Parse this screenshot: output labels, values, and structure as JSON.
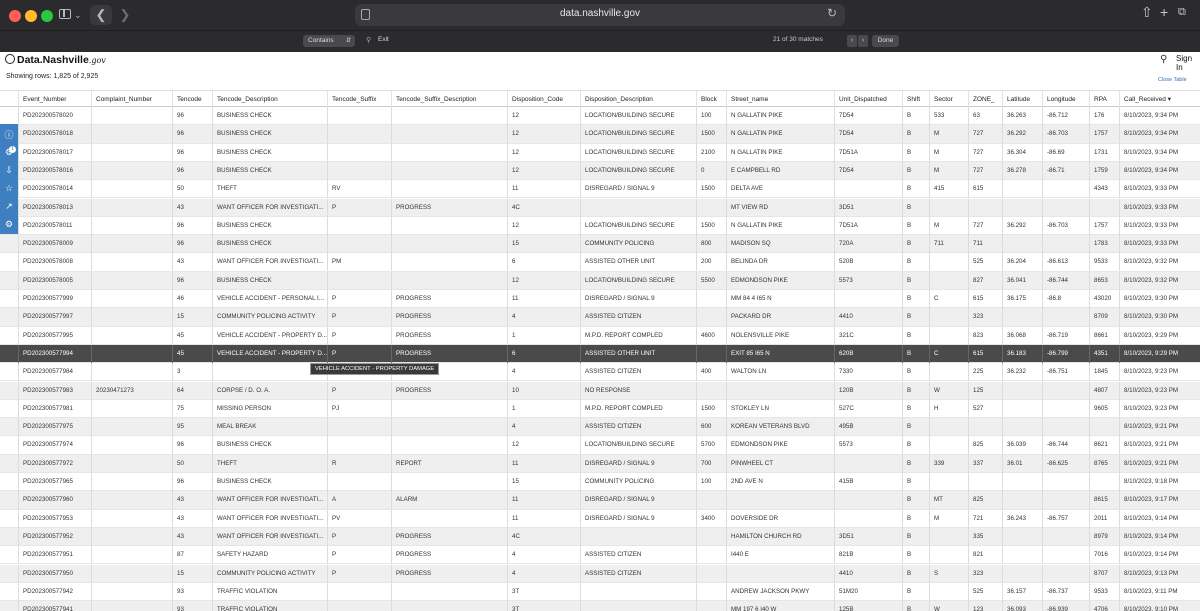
{
  "browser": {
    "url": "data.nashville.gov",
    "find": {
      "mode": "Contains",
      "query": "Exit",
      "match_count": "21 of 30 matches",
      "done_label": "Done"
    }
  },
  "header": {
    "logo_main": "Data.Nashville",
    "logo_suffix": ".gov",
    "sign_in": "Sign In",
    "showing_rows": "Showing rows: 1,825 of 2,925",
    "close_table": "Close Table"
  },
  "sidetools_badge": "1",
  "tooltip": "VEHICLE ACCIDENT - PROPERTY DAMAGE",
  "columns": [
    "Event_Number",
    "Complaint_Number",
    "Tencode",
    "Tencode_Description",
    "Tencode_Suffix",
    "Tencode_Suffix_Description",
    "Disposition_Code",
    "Disposition_Description",
    "Block",
    "Street_name",
    "Unit_Dispatched",
    "Shift",
    "Sector",
    "ZONE_",
    "Latitude",
    "Longitude",
    "RPA",
    "Call_Received ▾"
  ],
  "rows": [
    [
      "PD202300578020",
      "",
      "96",
      "BUSINESS CHECK",
      "",
      "",
      "12",
      "LOCATION/BUILDING SECURE",
      "100",
      "N GALLATIN PIKE",
      "7D54",
      "B",
      "533",
      "63",
      "36.263",
      "-86.712",
      "176",
      "8/10/2023, 9:34 PM"
    ],
    [
      "PD202300578018",
      "",
      "96",
      "BUSINESS CHECK",
      "",
      "",
      "12",
      "LOCATION/BUILDING SECURE",
      "1500",
      "N GALLATIN PIKE",
      "7D54",
      "B",
      "M",
      "727",
      "36.292",
      "-86.703",
      "1757",
      "8/10/2023, 9:34 PM"
    ],
    [
      "PD202300578017",
      "",
      "96",
      "BUSINESS CHECK",
      "",
      "",
      "12",
      "LOCATION/BUILDING SECURE",
      "2100",
      "N GALLATIN PIKE",
      "7D51A",
      "B",
      "M",
      "727",
      "36.304",
      "-86.69",
      "1731",
      "8/10/2023, 9:34 PM"
    ],
    [
      "PD202300578016",
      "",
      "96",
      "BUSINESS CHECK",
      "",
      "",
      "12",
      "LOCATION/BUILDING SECURE",
      "0",
      "E CAMPBELL RD",
      "7D54",
      "B",
      "M",
      "727",
      "36.278",
      "-86.71",
      "1759",
      "8/10/2023, 9:34 PM"
    ],
    [
      "PD202300578014",
      "",
      "50",
      "THEFT",
      "RV",
      "",
      "11",
      "DISREGARD / SIGNAL 9",
      "1500",
      "DELTA AVE",
      "",
      "B",
      "415",
      "615",
      "",
      "",
      "4343",
      "8/10/2023, 9:33 PM"
    ],
    [
      "PD202300578013",
      "",
      "43",
      "WANT OFFICER FOR INVESTIGATI...",
      "P",
      "PROGRESS",
      "4C",
      "",
      "",
      "MT VIEW RD",
      "3D51",
      "B",
      "",
      "",
      "",
      "",
      "",
      "8/10/2023, 9:33 PM"
    ],
    [
      "PD202300578011",
      "",
      "96",
      "BUSINESS CHECK",
      "",
      "",
      "12",
      "LOCATION/BUILDING SECURE",
      "1500",
      "N GALLATIN PIKE",
      "7D51A",
      "B",
      "M",
      "727",
      "36.292",
      "-86.703",
      "1757",
      "8/10/2023, 9:33 PM"
    ],
    [
      "PD202300578009",
      "",
      "96",
      "BUSINESS CHECK",
      "",
      "",
      "15",
      "COMMUNITY POLICING",
      "800",
      "MADISON SQ",
      "720A",
      "B",
      "711",
      "711",
      "",
      "",
      "1783",
      "8/10/2023, 9:33 PM"
    ],
    [
      "PD202300578008",
      "",
      "43",
      "WANT OFFICER FOR INVESTIGATI...",
      "PM",
      "",
      "6",
      "ASSISTED OTHER UNIT",
      "200",
      "BELINDA DR",
      "520B",
      "B",
      "",
      "525",
      "36.204",
      "-86.613",
      "9533",
      "8/10/2023, 9:32 PM"
    ],
    [
      "PD202300578005",
      "",
      "96",
      "BUSINESS CHECK",
      "",
      "",
      "12",
      "LOCATION/BUILDING SECURE",
      "5500",
      "EDMONDSON PIKE",
      "5573",
      "B",
      "",
      "827",
      "36.041",
      "-86.744",
      "8653",
      "8/10/2023, 9:32 PM"
    ],
    [
      "PD202300577999",
      "",
      "46",
      "VEHICLE ACCIDENT - PERSONAL I...",
      "P",
      "PROGRESS",
      "11",
      "DISREGARD / SIGNAL 9",
      "",
      "MM 84 4 I65 N",
      "",
      "B",
      "C",
      "615",
      "36.175",
      "-86.8",
      "43020",
      "8/10/2023, 9:30 PM"
    ],
    [
      "PD202300577997",
      "",
      "15",
      "COMMUNITY POLICING ACTIVITY",
      "P",
      "PROGRESS",
      "4",
      "ASSISTED CITIZEN",
      "",
      "PACKARD DR",
      "4410",
      "B",
      "",
      "323",
      "",
      "",
      "8709",
      "8/10/2023, 9:30 PM"
    ],
    [
      "PD202300577995",
      "",
      "45",
      "VEHICLE ACCIDENT - PROPERTY D...",
      "P",
      "PROGRESS",
      "1",
      "M.P.D. REPORT COMPLED",
      "4600",
      "NOLENSVILLE PIKE",
      "321C",
      "B",
      "",
      "823",
      "36.068",
      "-86.719",
      "8661",
      "8/10/2023, 9:29 PM"
    ],
    [
      "PD202300577994",
      "",
      "45",
      "VEHICLE ACCIDENT - PROPERTY D...",
      "P",
      "PROGRESS",
      "6",
      "ASSISTED OTHER UNIT",
      "",
      "EXIT 85 I65 N",
      "620B",
      "B",
      "C",
      "615",
      "36.183",
      "-86.799",
      "4351",
      "8/10/2023, 9:29 PM"
    ],
    [
      "PD202300577984",
      "",
      "3",
      "",
      "",
      "",
      "4",
      "ASSISTED CITIZEN",
      "400",
      "WALTON LN",
      "7330",
      "B",
      "",
      "225",
      "36.232",
      "-86.751",
      "1845",
      "8/10/2023, 9:23 PM"
    ],
    [
      "PD202300577983",
      "20230471273",
      "64",
      "CORPSE / D. O. A.",
      "P",
      "PROGRESS",
      "10",
      "NO RESPONSE",
      "",
      "",
      "120B",
      "B",
      "W",
      "125",
      "",
      "",
      "4807",
      "8/10/2023, 9:23 PM"
    ],
    [
      "PD202300577981",
      "",
      "75",
      "MISSING PERSON",
      "PJ",
      "",
      "1",
      "M.P.D. REPORT COMPLED",
      "1500",
      "STOKLEY LN",
      "527C",
      "B",
      "H",
      "527",
      "",
      "",
      "9605",
      "8/10/2023, 9:23 PM"
    ],
    [
      "PD202300577975",
      "",
      "95",
      "MEAL BREAK",
      "",
      "",
      "4",
      "ASSISTED CITIZEN",
      "600",
      "KOREAN VETERANS BLVD",
      "495B",
      "B",
      "",
      "",
      "",
      "",
      "",
      "8/10/2023, 9:21 PM"
    ],
    [
      "PD202300577974",
      "",
      "96",
      "BUSINESS CHECK",
      "",
      "",
      "12",
      "LOCATION/BUILDING SECURE",
      "5700",
      "EDMONDSON PIKE",
      "5573",
      "B",
      "",
      "825",
      "36.039",
      "-86.744",
      "8621",
      "8/10/2023, 9:21 PM"
    ],
    [
      "PD202300577972",
      "",
      "50",
      "THEFT",
      "R",
      "REPORT",
      "11",
      "DISREGARD / SIGNAL 9",
      "700",
      "PINWHEEL CT",
      "",
      "B",
      "339",
      "337",
      "36.01",
      "-86.625",
      "8765",
      "8/10/2023, 9:21 PM"
    ],
    [
      "PD202300577965",
      "",
      "96",
      "BUSINESS CHECK",
      "",
      "",
      "15",
      "COMMUNITY POLICING",
      "100",
      "2ND AVE N",
      "415B",
      "B",
      "",
      "",
      "",
      "",
      "",
      "8/10/2023, 9:18 PM"
    ],
    [
      "PD202300577960",
      "",
      "43",
      "WANT OFFICER FOR INVESTIGATI...",
      "A",
      "ALARM",
      "11",
      "DISREGARD / SIGNAL 9",
      "",
      "",
      "",
      "B",
      "MT",
      "825",
      "",
      "",
      "8615",
      "8/10/2023, 9:17 PM"
    ],
    [
      "PD202300577953",
      "",
      "43",
      "WANT OFFICER FOR INVESTIGATI...",
      "PV",
      "",
      "11",
      "DISREGARD / SIGNAL 9",
      "3400",
      "DOVERSIDE DR",
      "",
      "B",
      "M",
      "721",
      "36.243",
      "-86.757",
      "2011",
      "8/10/2023, 9:14 PM"
    ],
    [
      "PD202300577952",
      "",
      "43",
      "WANT OFFICER FOR INVESTIGATI...",
      "P",
      "PROGRESS",
      "4C",
      "",
      "",
      "HAMILTON CHURCH RD",
      "3D51",
      "B",
      "",
      "335",
      "",
      "",
      "8979",
      "8/10/2023, 9:14 PM"
    ],
    [
      "PD202300577951",
      "",
      "87",
      "SAFETY HAZARD",
      "P",
      "PROGRESS",
      "4",
      "ASSISTED CITIZEN",
      "",
      "I440 E",
      "821B",
      "B",
      "",
      "821",
      "",
      "",
      "7016",
      "8/10/2023, 9:14 PM"
    ],
    [
      "PD202300577950",
      "",
      "15",
      "COMMUNITY POLICING ACTIVITY",
      "P",
      "PROGRESS",
      "4",
      "ASSISTED CITIZEN",
      "",
      "",
      "4410",
      "B",
      "S",
      "323",
      "",
      "",
      "8707",
      "8/10/2023, 9:13 PM"
    ],
    [
      "PD202300577942",
      "",
      "93",
      "TRAFFIC VIOLATION",
      "",
      "",
      "3T",
      "",
      "",
      "ANDREW JACKSON PKWY",
      "51M20",
      "B",
      "",
      "525",
      "36.157",
      "-86.737",
      "9533",
      "8/10/2023, 9:11 PM"
    ],
    [
      "PD202300577941",
      "",
      "93",
      "TRAFFIC VIOLATION",
      "",
      "",
      "3T",
      "",
      "",
      "MM 197 6 I40 W",
      "125B",
      "B",
      "W",
      "123",
      "36.093",
      "-86.939",
      "4706",
      "8/10/2023, 9:10 PM"
    ]
  ]
}
